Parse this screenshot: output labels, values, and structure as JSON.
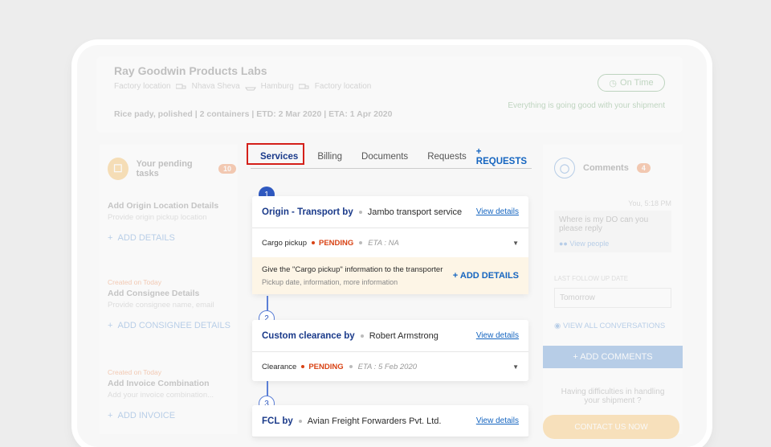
{
  "shipment": {
    "company": "Ray Goodwin Products Labs",
    "route": [
      "Factory location",
      "Nhava Sheva",
      "Hamburg",
      "Factory location"
    ],
    "meta": "Rice pady, polished  |  2 containers  |  ETD: 2 Mar 2020  |  ETA: 1 Apr 2020",
    "status": "On Time",
    "status_msg": "Everything is going good with your shipment"
  },
  "left": {
    "pending_label": "Your pending tasks",
    "pending_count": "10",
    "tasks": [
      {
        "tag": "",
        "title": "Add Origin Location Details",
        "sub": "Provide origin pickup location",
        "action": "ADD DETAILS"
      },
      {
        "tag": "Created on Today",
        "title": "Add Consignee Details",
        "sub": "Provide consignee name, email",
        "action": "ADD CONSIGNEE DETAILS"
      },
      {
        "tag": "Created on Today",
        "title": "Add Invoice Combination",
        "sub": "Add your invoice combination...",
        "action": "ADD INVOICE"
      }
    ]
  },
  "tabs": [
    "Services",
    "Billing",
    "Documents",
    "Requests"
  ],
  "requests_label": "+ REQUESTS",
  "services": [
    {
      "num": "1",
      "title": "Origin - Transport by",
      "provider": "Jambo transport service",
      "view": "View details",
      "task": "Cargo pickup",
      "status": "PENDING",
      "eta": "ETA : NA",
      "info_title": "Give the \"Cargo pickup\" information to the transporter",
      "info_sub": "Pickup date, information, more information",
      "info_action": "+ ADD DETAILS"
    },
    {
      "num": "2",
      "title": "Custom clearance by",
      "provider": "Robert Armstrong",
      "view": "View details",
      "task": "Clearance",
      "status": "PENDING",
      "eta": "ETA : 5 Feb 2020"
    },
    {
      "num": "3",
      "title": "FCL by",
      "provider": "Avian Freight Forwarders Pvt. Ltd.",
      "view": "View details"
    }
  ],
  "comments": {
    "title": "Comments",
    "count": "4",
    "time": "You, 5:18 PM",
    "message": "Where is my DO can you please reply",
    "view_people": "View people",
    "waiting": "LAST FOLLOW UP DATE",
    "followup": "Tomorrow",
    "view_all": "VIEW ALL CONVERSATIONS",
    "add": "+ ADD COMMENTS",
    "help": "Having difficulties in handling your shipment ?",
    "contact": "CONTACT US NOW"
  },
  "colors": {
    "accent": "#1a3a8a",
    "link": "#1565c0",
    "pending": "#d84315",
    "highlight": "#d4201a"
  }
}
